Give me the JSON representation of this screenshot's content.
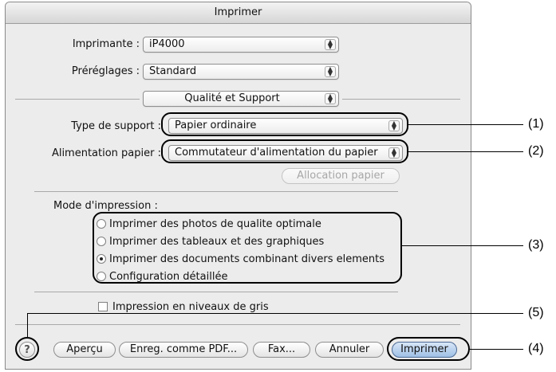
{
  "window": {
    "title": "Imprimer"
  },
  "printer": {
    "label": "Imprimante :",
    "value": "iP4000"
  },
  "presets": {
    "label": "Préréglages :",
    "value": "Standard"
  },
  "panel": {
    "value": "Qualité et Support"
  },
  "media_type": {
    "label": "Type de support :",
    "value": "Papier ordinaire"
  },
  "paper_source": {
    "label": "Alimentation papier :",
    "value": "Commutateur d'alimentation du papier"
  },
  "paper_allocation_button": {
    "label": "Allocation papier"
  },
  "print_mode": {
    "label": "Mode d'impression :",
    "options": [
      {
        "label": "Imprimer des photos de qualite optimale"
      },
      {
        "label": "Imprimer des tableaux et des graphiques"
      },
      {
        "label": "Imprimer des documents combinant divers elements"
      },
      {
        "label": "Configuration détaillée"
      }
    ],
    "selected": "Imprimer des documents combinant divers elements"
  },
  "grayscale": {
    "label": "Impression en niveaux de gris",
    "checked": false
  },
  "buttons": {
    "help": "?",
    "preview": "Aperçu",
    "save_pdf": "Enreg. comme PDF...",
    "fax": "Fax...",
    "cancel": "Annuler",
    "print": "Imprimer"
  },
  "callouts": [
    "(1)",
    "(2)",
    "(3)",
    "(4)",
    "(5)"
  ]
}
